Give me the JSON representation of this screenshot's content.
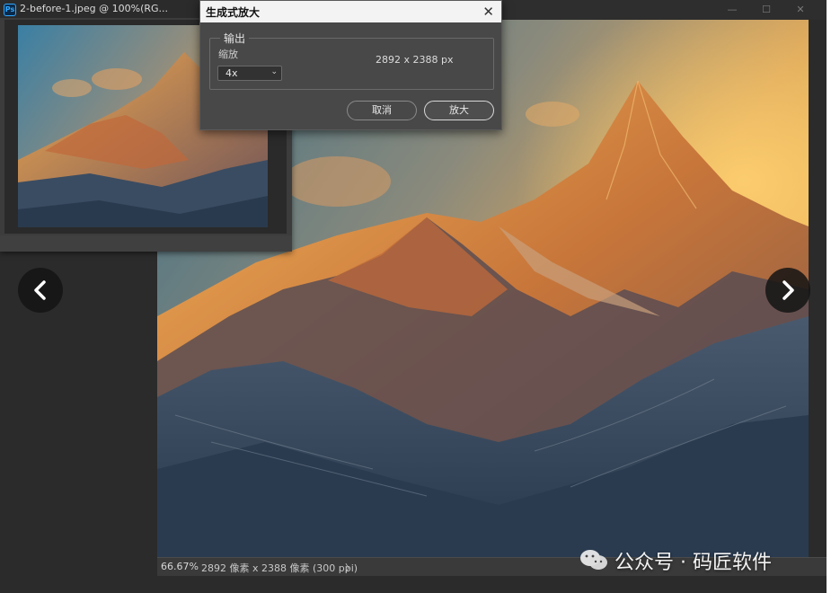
{
  "main_window": {
    "title": "2-before-1.jpeg @ 100%(RG...",
    "app_icon": "Ps",
    "minimize_icon": "minimize-icon",
    "maximize_icon": "maximize-icon",
    "close_icon": "close-icon"
  },
  "status_bar": {
    "zoom": "66.67%",
    "dimensions": "2892 像素 x 2388 像素 (300 ppi)",
    "arrow": "〉"
  },
  "dialog": {
    "title": "生成式放大",
    "close_glyph": "✕",
    "group_label": "输出",
    "scale_label": "缩放",
    "scale_value": "4x",
    "pixel_size": "2892 x 2388 px",
    "cancel_label": "取消",
    "ok_label": "放大"
  },
  "watermark": {
    "text": "公众号 · 码匠软件"
  },
  "colors": {
    "dialog_bg": "#484848",
    "title_bar_bg": "#f3f3f3",
    "status_bar_bg": "#3a3a3a"
  }
}
